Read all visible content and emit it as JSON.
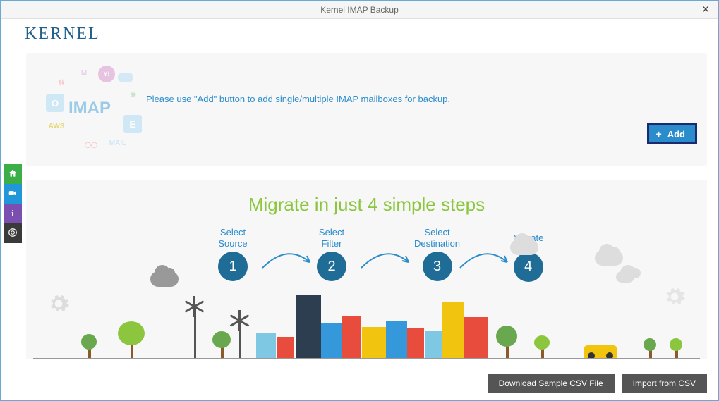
{
  "window": {
    "title": "Kernel IMAP Backup"
  },
  "brand": {
    "name": "KERNEL"
  },
  "topPanel": {
    "imap_label": "IMAP",
    "instruction": "Please use \"Add\" button to add single/multiple IMAP mailboxes for backup.",
    "add_label": "Add",
    "cloud_icons": {
      "m": "M",
      "mail": "MAIL",
      "y": "Y!",
      "n": "N",
      "e": "E",
      "o": "O",
      "aws": "AWS"
    }
  },
  "steps": {
    "title": "Migrate in just 4 simple steps",
    "items": [
      {
        "label": "Select\nSource",
        "num": "1"
      },
      {
        "label": "Select\nFilter",
        "num": "2"
      },
      {
        "label": "Select\nDestination",
        "num": "3"
      },
      {
        "label": "Migrate",
        "num": "4"
      }
    ]
  },
  "buttons": {
    "download_csv": "Download Sample CSV File",
    "import_csv": "Import from CSV"
  }
}
